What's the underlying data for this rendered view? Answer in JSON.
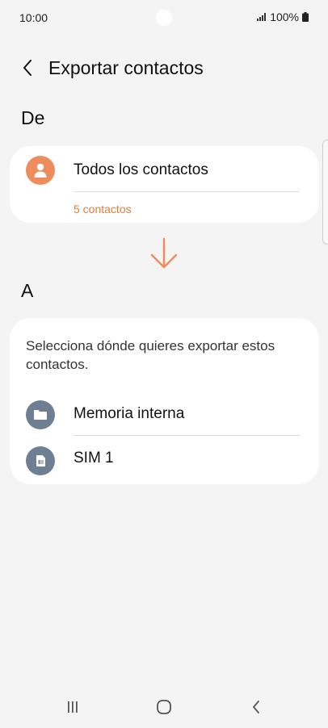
{
  "status_bar": {
    "time": "10:00",
    "battery": "100%"
  },
  "header": {
    "title": "Exportar contactos"
  },
  "from_section": {
    "label": "De",
    "option": {
      "label": "Todos los contactos",
      "count": "5 contactos",
      "icon": "person-icon",
      "icon_color": "#ee8c5e"
    }
  },
  "to_section": {
    "label": "A",
    "description": "Selecciona dónde quieres exportar estos contactos.",
    "options": [
      {
        "label": "Memoria interna",
        "icon": "folder-icon",
        "icon_color": "#6f7f93"
      },
      {
        "label": "SIM 1",
        "icon": "sim-card-icon",
        "icon_color": "#6f7f93"
      }
    ]
  },
  "colors": {
    "accent": "#e57b3a",
    "background": "#f4f4f4",
    "card": "#ffffff"
  }
}
